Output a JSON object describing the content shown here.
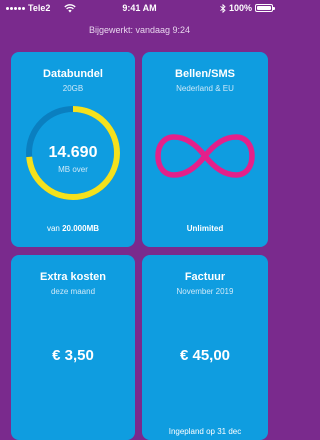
{
  "status_bar": {
    "carrier": "Tele2",
    "time": "9:41 AM",
    "battery": "100%",
    "battery_level": 1.0
  },
  "updated_label": "Bijgewerkt: vandaag 9:24",
  "colors": {
    "background": "#7a2a8d",
    "card": "#0f9de0",
    "gauge_used": "#f5e11c",
    "gauge_track": "#0a7fc0",
    "infinity": "#e4208a"
  },
  "data_card": {
    "title": "Databundel",
    "subtitle": "20GB",
    "remaining_value": "14.690",
    "remaining_unit": "MB over",
    "footer_prefix": "van",
    "footer_total": "20.000MB",
    "remaining_fraction": 0.7345
  },
  "sms_card": {
    "title": "Bellen/SMS",
    "subtitle": "Nederland & EU",
    "icon": "infinity-icon",
    "footer": "Unlimited"
  },
  "extra_costs_card": {
    "title": "Extra kosten",
    "subtitle": "deze maand",
    "amount": "€ 3,50"
  },
  "invoice_card": {
    "title": "Factuur",
    "subtitle": "November 2019",
    "amount": "€ 45,00",
    "footer": "Ingepland op 31 dec"
  }
}
